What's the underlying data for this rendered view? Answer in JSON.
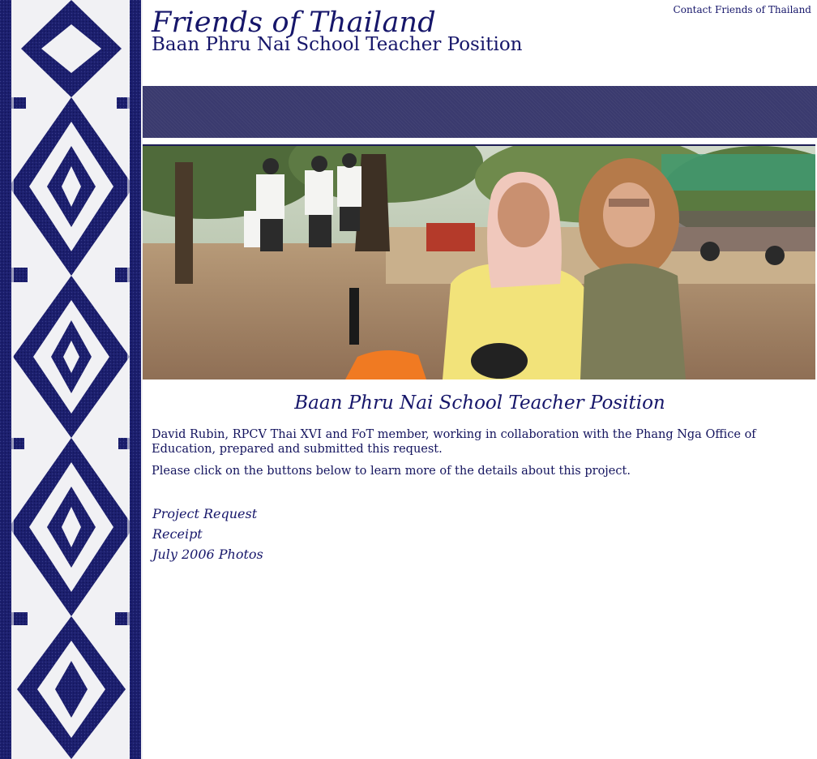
{
  "header": {
    "site_title": "Friends of Thailand",
    "subtitle": "Baan Phru Nai School Teacher Position",
    "contact_link": "Contact Friends of Thailand"
  },
  "main": {
    "heading": "Baan Phru Nai School Teacher Position",
    "paragraphs": [
      "David Rubin, RPCV Thai XVI and FoT member, working in collaboration with the Phang Nga Office of Education, prepared and submitted this request.",
      "Please click on the buttons below to learn more of the details about this project."
    ],
    "links": [
      "Project Request",
      "Receipt",
      "July 2006 Photos"
    ]
  },
  "colors": {
    "text_navy": "#16166a",
    "banner": "#3a3a6e",
    "weave_blue": "#1c1f6e",
    "weave_light": "#f1f1f4"
  },
  "icons": {
    "left_strip": "ikat-weave-pattern",
    "photo": "two-women-on-scooter-photo"
  }
}
